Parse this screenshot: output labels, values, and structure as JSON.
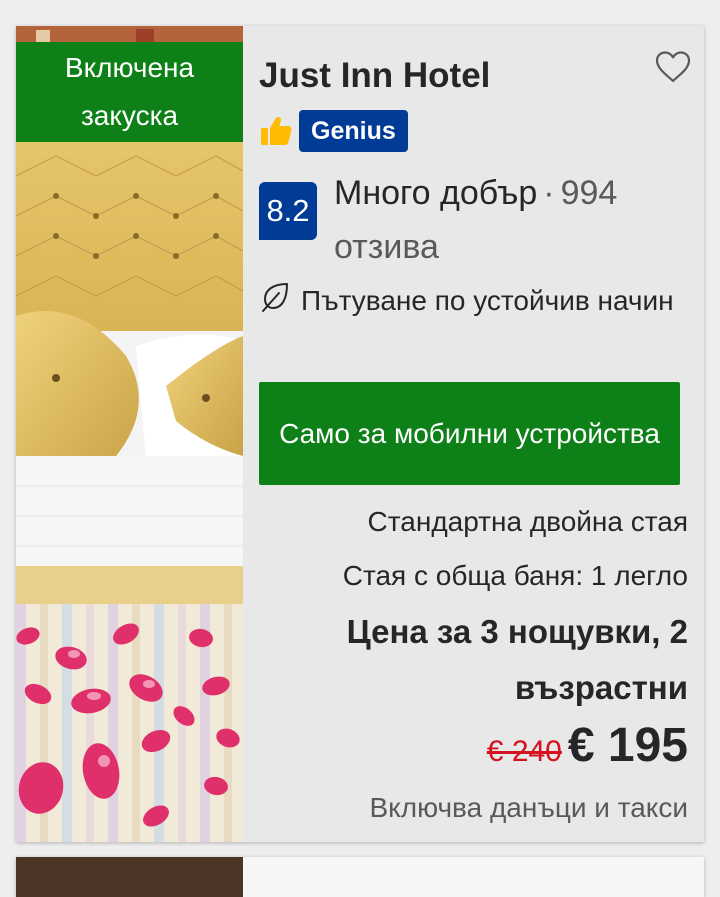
{
  "listing": {
    "badge_breakfast": "Включена закуска",
    "hotel_name": "Just Inn Hotel",
    "genius_label": "Genius",
    "score": "8.2",
    "rating_word": "Много добър",
    "rating_separator": "·",
    "reviews": "994 отзива",
    "sustainability_label": "Пътуване по устойчив начин",
    "mobile_only_label": "Само за мобилни устройства",
    "room_type": "Стандартна двойна стая",
    "room_detail": "Стая с обща баня: 1 легло",
    "price_for": "Цена за 3 нощувки, 2 възрастни",
    "old_price": "€ 240",
    "new_price": "€ 195",
    "taxes_note": "Включва данъци и такси"
  },
  "icons": {
    "favorite": "heart-outline-icon",
    "genius_thumb": "thumbs-up-icon",
    "sustainability": "leaf-icon"
  },
  "colors": {
    "badge_green": "#0d8018",
    "brand_blue": "#003b95",
    "old_price_red": "#d4111e",
    "thumb_yellow": "#febb02"
  }
}
